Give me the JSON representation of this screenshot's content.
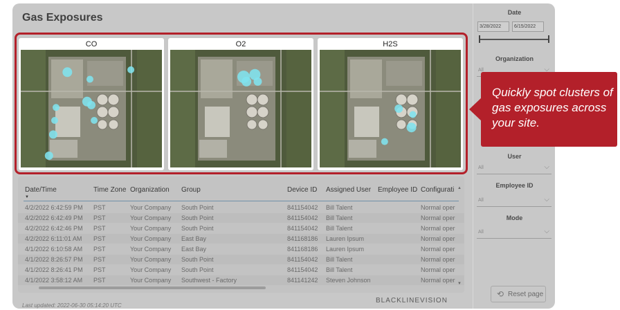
{
  "page": {
    "title": "Gas Exposures",
    "brand": "BLACKLINEVISION",
    "last_updated": "Last updated: 2022-06-30 05:14:20 UTC"
  },
  "maps": [
    {
      "label": "CO",
      "blobs": [
        [
          0.09,
          0.11
        ],
        [
          0.38,
          0.4
        ],
        [
          0.2,
          0.36
        ],
        [
          0.63,
          0.34
        ],
        [
          0.34,
          0.44
        ],
        [
          0.32,
          0.7
        ],
        [
          0.3,
          0.76
        ],
        [
          0.2,
          0.8
        ],
        [
          0.34,
          0.8
        ],
        [
          0.63,
          0.8
        ],
        [
          0.65,
          0.82
        ],
        [
          0.64,
          0.82
        ],
        [
          0.58,
          0.84
        ]
      ]
    },
    {
      "label": "O2",
      "blobs": [
        [
          0.2,
          0.2
        ]
      ]
    },
    {
      "label": "H2S",
      "blobs": [
        [
          0.2,
          0.2
        ]
      ]
    }
  ],
  "table": {
    "headers": [
      "Date/Time",
      "Time Zone",
      "Organization",
      "Group",
      "Device ID",
      "Assigned User",
      "Employee ID",
      "Configurati"
    ],
    "rows": [
      [
        "4/2/2022 6:42:59 PM",
        "PST",
        "Your Company",
        "South Point",
        "841154042",
        "Bill Talent",
        "",
        "Normal oper"
      ],
      [
        "4/2/2022 6:42:49 PM",
        "PST",
        "Your Company",
        "South Point",
        "841154042",
        "Bill Talent",
        "",
        "Normal oper"
      ],
      [
        "4/2/2022 6:42:46 PM",
        "PST",
        "Your Company",
        "South Point",
        "841154042",
        "Bill Talent",
        "",
        "Normal oper"
      ],
      [
        "4/2/2022 6:11:01 AM",
        "PST",
        "Your Company",
        "East Bay",
        "841168186",
        "Lauren Ipsum",
        "",
        "Normal oper"
      ],
      [
        "4/1/2022 6:10:58 AM",
        "PST",
        "Your Company",
        "East Bay",
        "841168186",
        "Lauren Ipsum",
        "",
        "Normal oper"
      ],
      [
        "4/1/2022 8:26:57 PM",
        "PST",
        "Your Company",
        "South Point",
        "841154042",
        "Bill Talent",
        "",
        "Normal oper"
      ],
      [
        "4/1/2022 8:26:41 PM",
        "PST",
        "Your Company",
        "South Point",
        "841154042",
        "Bill Talent",
        "",
        "Normal oper"
      ],
      [
        "4/1/2022 3:58:12 AM",
        "PST",
        "Your Company",
        "Southwest - Factory",
        "841141242",
        "Steven Johnson",
        "",
        "Normal oper"
      ]
    ]
  },
  "filters": {
    "date_label": "Date",
    "date_start": "3/28/2022",
    "date_end": "6/15/2022",
    "organization_label": "Organization",
    "organization_value": "All",
    "user_label": "User",
    "user_value": "All",
    "employee_label": "Employee ID",
    "employee_value": "All",
    "mode_label": "Mode",
    "mode_value": "All",
    "reset_label": "Reset page"
  },
  "callout": {
    "text": "Quickly spot clusters of gas exposures across your site."
  },
  "colors": {
    "accent_red": "#b3202a",
    "blob": "#7fe3ee"
  }
}
